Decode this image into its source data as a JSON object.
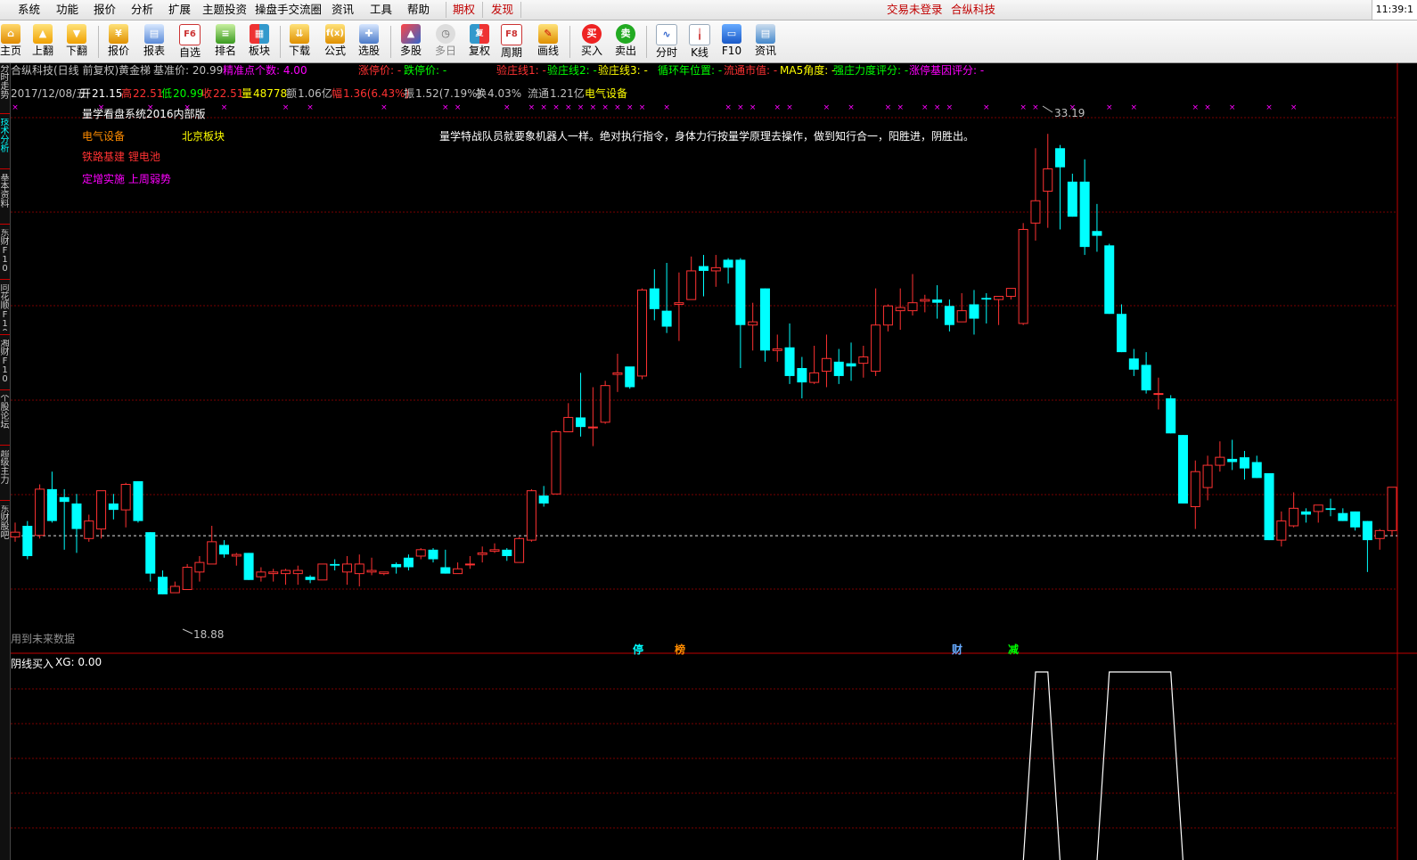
{
  "menu": {
    "items": [
      "系统",
      "功能",
      "报价",
      "分析",
      "扩展",
      "主题投资",
      "操盘手交流圈",
      "资讯",
      "工具",
      "帮助"
    ],
    "futures": "期权",
    "discover": "发现",
    "login_status": "交易未登录",
    "broker": "合纵科技",
    "clock": "11:39:1"
  },
  "toolbar": {
    "buttons": [
      {
        "label": "主页",
        "icon": "home-icon"
      },
      {
        "label": "上翻",
        "icon": "arrow-up-icon"
      },
      {
        "label": "下翻",
        "icon": "arrow-down-icon"
      },
      {
        "label": "报价",
        "icon": "yen-icon"
      },
      {
        "label": "报表",
        "icon": "report-icon"
      },
      {
        "label": "自选",
        "icon": "f6-icon"
      },
      {
        "label": "排名",
        "icon": "ranking-icon"
      },
      {
        "label": "板块",
        "icon": "sector-icon"
      },
      {
        "label": "下载",
        "icon": "download-icon"
      },
      {
        "label": "公式",
        "icon": "formula-icon"
      },
      {
        "label": "选股",
        "icon": "stock-picker-icon"
      },
      {
        "label": "多股",
        "icon": "multi-stock-icon"
      },
      {
        "label": "多日",
        "icon": "multi-day-icon"
      },
      {
        "label": "复权",
        "icon": "adjust-icon"
      },
      {
        "label": "周期",
        "icon": "f8-icon"
      },
      {
        "label": "画线",
        "icon": "draw-line-icon"
      },
      {
        "label": "买入",
        "icon": "buy-icon"
      },
      {
        "label": "卖出",
        "icon": "sell-icon"
      },
      {
        "label": "分时",
        "icon": "intraday-icon"
      },
      {
        "label": "K线",
        "icon": "kline-icon"
      },
      {
        "label": "F10",
        "icon": "f10-icon"
      },
      {
        "label": "资讯",
        "icon": "news-icon"
      }
    ]
  },
  "sidebar": {
    "tabs": [
      "分时走势",
      "技术分析",
      "基本资料",
      "东财F10",
      "同花顺F10",
      "湘财F10",
      "个股论坛",
      "超级主力",
      "东财股吧"
    ]
  },
  "info_bar": {
    "stock": "合纵科技(日线 前复权)",
    "gold_line": "黄金梯",
    "base_price_label": "基准价: 20.99",
    "precise_points": "精准点个数: 4.00",
    "limit_up": "涨停价: -",
    "limit_down": "跌停价: -",
    "verify1": "验庄线1: -",
    "verify2": "验庄线2: -",
    "verify3": "验庄线3: -",
    "cycle_pos": "循环年位置: -",
    "market_cap": "流通市值: -",
    "ma5_angle": "MA5角度: -",
    "strength": "强庄力度评分: -",
    "limit_gene": "涨停基因评分: -"
  },
  "quote_bar": {
    "date": "2017/12/08/五",
    "open_label": "开",
    "open": "21.15",
    "high_label": "高",
    "high": "22.51",
    "low_label": "低",
    "low": "20.99",
    "close_label": "收",
    "close": "22.51",
    "volume_label": "量",
    "volume": "48778",
    "amount_label": "额",
    "amount": "1.06亿",
    "change_label": "幅",
    "change": "1.36(6.43%)",
    "amplitude_label": "振",
    "amplitude": "1.52(7.19%)",
    "turnover_label": "换",
    "turnover": "4.03%",
    "float_label": "流通",
    "float_value": "1.21亿",
    "sector": "电气设备"
  },
  "overlay": {
    "system": "量学看盘系统2016内部版",
    "industry": "电气设备",
    "region": "北京板块",
    "concept": "铁路基建 锂电池",
    "event": "定增实施 上周弱势",
    "slogan": "量学特战队员就要象机器人一样。绝对执行指令，身体力行按量学原理去操作，做到知行合一，阳胜进，阴胜出。",
    "future_data": "用到未来数据",
    "peak_label": "33.19",
    "trough_label": "18.88",
    "markers": [
      "停",
      "榜",
      "财",
      "减"
    ]
  },
  "indicator": {
    "title": "阴线买入",
    "xg_label": "XG: 0.00",
    "signal_points": [
      {
        "index": 83,
        "value": 1
      },
      {
        "index": 84,
        "value": 1
      },
      {
        "index": 89,
        "value": 1
      },
      {
        "index": 90,
        "value": 1
      },
      {
        "index": 91,
        "value": 1
      },
      {
        "index": 92,
        "value": 1
      },
      {
        "index": 93,
        "value": 1
      },
      {
        "index": 94,
        "value": 1
      }
    ]
  },
  "colors": {
    "up": "#ff3232",
    "down": "#00ffff",
    "grid": "#8b0000",
    "text": "#c0c0c0",
    "magenta": "#ff00ff",
    "yellow": "#ffff00",
    "green": "#00ff00"
  },
  "chart_data": {
    "type": "candlestick",
    "price_range": [
      18.0,
      34.5
    ],
    "grid": true,
    "reference_price": 20.99,
    "candles": [
      [
        20.95,
        21.1,
        21.4,
        20.8
      ],
      [
        21.3,
        20.35,
        21.45,
        20.25
      ],
      [
        21.0,
        22.45,
        22.6,
        20.9
      ],
      [
        22.45,
        21.45,
        23.0,
        21.4
      ],
      [
        22.2,
        22.05,
        22.45,
        20.55
      ],
      [
        22.0,
        21.2,
        22.3,
        20.45
      ],
      [
        20.9,
        21.45,
        21.65,
        20.8
      ],
      [
        21.2,
        22.4,
        22.4,
        20.9
      ],
      [
        22.0,
        21.8,
        22.3,
        21.5
      ],
      [
        21.8,
        22.6,
        22.65,
        21.25
      ],
      [
        22.7,
        21.45,
        22.7,
        21.4
      ],
      [
        21.1,
        19.8,
        21.1,
        19.55
      ],
      [
        19.7,
        19.15,
        19.9,
        19.15
      ],
      [
        19.2,
        19.4,
        19.55,
        19.2
      ],
      [
        19.3,
        20.0,
        20.1,
        19.3
      ],
      [
        19.85,
        20.15,
        20.35,
        19.55
      ],
      [
        20.1,
        20.8,
        21.3,
        20.1
      ],
      [
        20.7,
        20.4,
        20.85,
        20.3
      ],
      [
        20.35,
        20.4,
        20.45,
        20.05
      ],
      [
        20.45,
        19.6,
        20.45,
        19.6
      ],
      [
        19.7,
        19.85,
        20.0,
        19.55
      ],
      [
        19.8,
        19.85,
        19.95,
        19.55
      ],
      [
        19.8,
        19.9,
        19.95,
        19.45
      ],
      [
        19.8,
        19.9,
        20.05,
        19.45
      ],
      [
        19.7,
        19.6,
        19.75,
        19.5
      ],
      [
        19.6,
        20.1,
        20.1,
        19.6
      ],
      [
        20.1,
        20.05,
        20.25,
        19.9
      ],
      [
        19.85,
        20.1,
        20.35,
        19.45
      ],
      [
        19.8,
        20.1,
        20.4,
        19.4
      ],
      [
        19.85,
        19.9,
        20.3,
        19.75
      ],
      [
        19.8,
        19.85,
        19.85,
        19.75
      ],
      [
        20.1,
        20.0,
        20.15,
        19.8
      ],
      [
        20.3,
        20.0,
        20.4,
        19.9
      ],
      [
        20.35,
        20.55,
        20.6,
        20.25
      ],
      [
        20.55,
        20.25,
        20.6,
        20.15
      ],
      [
        20.0,
        19.8,
        20.55,
        19.8
      ],
      [
        19.8,
        19.95,
        20.15,
        19.8
      ],
      [
        20.1,
        20.1,
        20.35,
        19.95
      ],
      [
        20.4,
        20.45,
        20.65,
        20.15
      ],
      [
        20.5,
        20.55,
        20.75,
        20.45
      ],
      [
        20.55,
        20.35,
        20.6,
        20.2
      ],
      [
        20.15,
        20.9,
        20.95,
        20.15
      ],
      [
        20.85,
        22.4,
        22.45,
        20.8
      ],
      [
        22.25,
        22.0,
        22.55,
        21.9
      ],
      [
        22.3,
        24.25,
        24.3,
        22.3
      ],
      [
        24.25,
        24.7,
        25.15,
        24.25
      ],
      [
        24.7,
        24.4,
        26.1,
        24.1
      ],
      [
        24.4,
        24.4,
        25.65,
        23.8
      ],
      [
        24.55,
        25.7,
        25.85,
        24.5
      ],
      [
        26.05,
        26.1,
        26.7,
        25.5
      ],
      [
        26.3,
        25.65,
        26.25,
        25.6
      ],
      [
        26.0,
        28.7,
        28.75,
        25.9
      ],
      [
        28.75,
        28.1,
        29.35,
        27.75
      ],
      [
        28.05,
        27.55,
        29.55,
        27.35
      ],
      [
        28.25,
        28.3,
        29.25,
        27.1
      ],
      [
        28.4,
        29.3,
        29.75,
        28.4
      ],
      [
        29.45,
        29.3,
        29.8,
        28.5
      ],
      [
        29.3,
        29.4,
        29.8,
        28.8
      ],
      [
        29.65,
        29.4,
        29.7,
        28.9
      ],
      [
        29.65,
        27.6,
        29.7,
        26.25
      ],
      [
        27.6,
        27.7,
        28.3,
        26.8
      ],
      [
        28.75,
        26.8,
        28.75,
        26.45
      ],
      [
        26.8,
        26.85,
        27.3,
        26.45
      ],
      [
        26.9,
        26.0,
        27.65,
        25.75
      ],
      [
        26.25,
        25.8,
        26.6,
        25.3
      ],
      [
        25.8,
        26.1,
        26.95,
        25.75
      ],
      [
        26.15,
        26.55,
        27.3,
        25.65
      ],
      [
        26.45,
        26.0,
        26.85,
        25.75
      ],
      [
        26.4,
        26.3,
        27.05,
        25.85
      ],
      [
        26.4,
        26.6,
        26.95,
        25.95
      ],
      [
        26.15,
        27.6,
        28.75,
        26.0
      ],
      [
        27.6,
        28.2,
        28.25,
        27.4
      ],
      [
        28.05,
        28.15,
        28.75,
        27.45
      ],
      [
        28.05,
        28.3,
        29.2,
        27.9
      ],
      [
        28.35,
        28.4,
        28.55,
        28.0
      ],
      [
        28.4,
        28.3,
        28.85,
        27.8
      ],
      [
        28.2,
        27.6,
        28.4,
        27.4
      ],
      [
        27.7,
        28.05,
        28.6,
        27.7
      ],
      [
        28.25,
        27.8,
        28.7,
        27.3
      ],
      [
        28.45,
        28.4,
        28.6,
        27.65
      ],
      [
        28.4,
        28.5,
        28.5,
        27.6
      ],
      [
        28.5,
        28.75,
        28.75,
        28.4
      ],
      [
        27.65,
        30.6,
        30.8,
        27.6
      ],
      [
        30.8,
        31.5,
        33.15,
        30.25
      ],
      [
        31.8,
        32.5,
        33.6,
        30.65
      ],
      [
        33.15,
        32.55,
        33.25,
        30.6
      ],
      [
        32.1,
        31.0,
        32.35,
        31.0
      ],
      [
        32.1,
        30.05,
        32.8,
        29.8
      ],
      [
        30.55,
        30.4,
        31.4,
        29.9
      ],
      [
        30.1,
        27.95,
        30.15,
        27.95
      ],
      [
        27.95,
        26.75,
        28.25,
        26.75
      ],
      [
        26.55,
        26.2,
        26.85,
        26.0
      ],
      [
        26.35,
        25.55,
        26.75,
        25.45
      ],
      [
        25.45,
        25.45,
        25.95,
        24.95
      ],
      [
        25.3,
        24.2,
        25.4,
        24.2
      ],
      [
        24.15,
        22.0,
        24.15,
        22.0
      ],
      [
        21.9,
        23.0,
        23.35,
        21.2
      ],
      [
        22.5,
        23.2,
        23.5,
        22.1
      ],
      [
        23.2,
        23.45,
        23.95,
        23.0
      ],
      [
        23.4,
        23.3,
        24.0,
        23.05
      ],
      [
        23.45,
        23.1,
        23.65,
        22.75
      ],
      [
        23.3,
        22.8,
        23.5,
        22.8
      ],
      [
        22.95,
        20.85,
        22.95,
        20.85
      ],
      [
        20.85,
        21.45,
        21.75,
        20.65
      ],
      [
        21.3,
        21.85,
        22.35,
        21.25
      ],
      [
        21.75,
        21.65,
        21.85,
        21.4
      ],
      [
        21.75,
        21.95,
        21.95,
        21.4
      ],
      [
        21.85,
        21.8,
        22.15,
        21.6
      ],
      [
        21.7,
        21.45,
        21.85,
        21.45
      ],
      [
        21.75,
        21.25,
        21.75,
        21.15
      ],
      [
        21.45,
        20.85,
        21.45,
        19.85
      ],
      [
        20.9,
        21.15,
        21.2,
        20.55
      ],
      [
        21.15,
        22.51,
        22.51,
        20.99
      ]
    ]
  }
}
